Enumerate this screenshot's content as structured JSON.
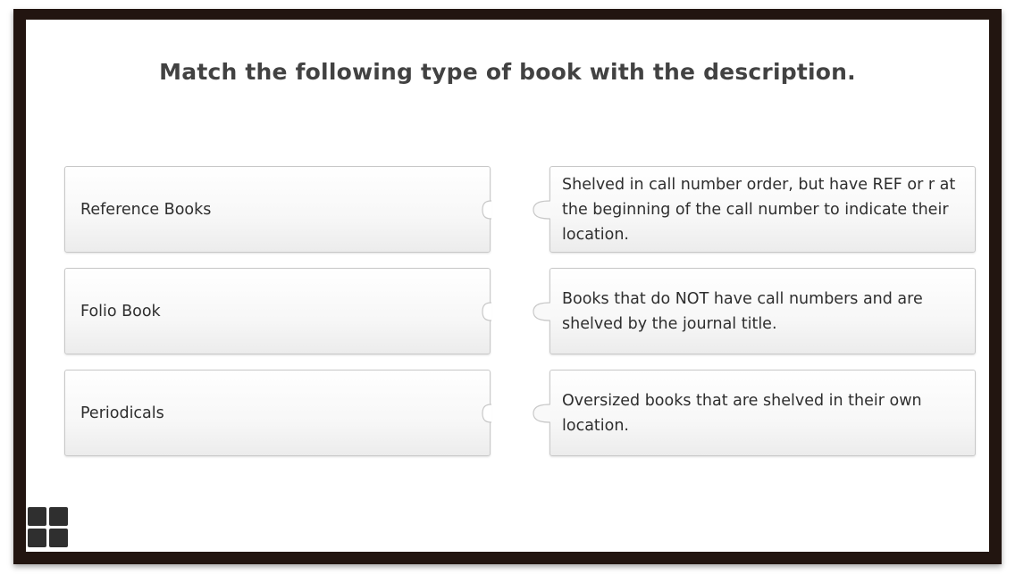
{
  "title": "Match the following type of book with the description.",
  "left_items": [
    {
      "label": "Reference Books"
    },
    {
      "label": "Folio Book"
    },
    {
      "label": "Periodicals"
    }
  ],
  "right_items": [
    {
      "label": "Shelved in call number order, but have REF or r at the beginning of the call number to indicate their location."
    },
    {
      "label": "Books that do NOT have call numbers and are shelved by the journal title."
    },
    {
      "label": "Oversized books that are shelved in their own location."
    }
  ],
  "icons": {
    "menu": "grid-menu-icon",
    "puzzle_slot": "puzzle-slot-icon",
    "puzzle_tab": "puzzle-tab-icon"
  },
  "colors": {
    "frame": "#221510",
    "title": "#424242",
    "card_border": "#c8c8c8",
    "text": "#2e2e2e"
  }
}
